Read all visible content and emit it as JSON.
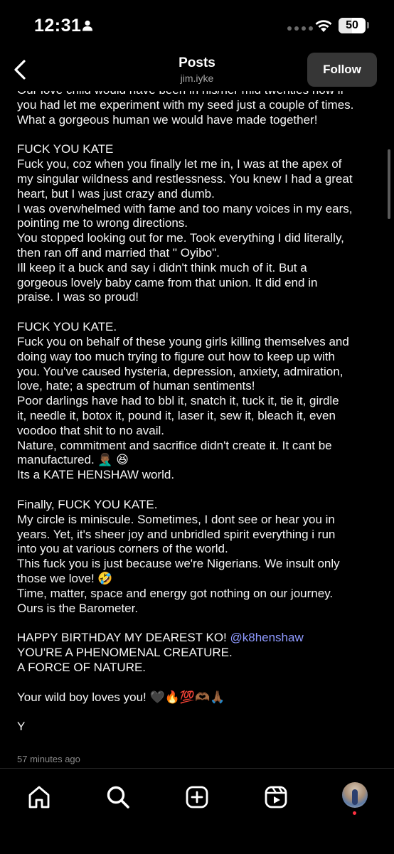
{
  "status_bar": {
    "time": "12:31",
    "battery": "50"
  },
  "header": {
    "title": "Posts",
    "username": "jim.iyke",
    "follow_label": "Follow"
  },
  "post": {
    "lines": [
      "Our love child would have been in his/her mid twenties now if",
      "you had let me experiment with my seed just a couple of times.",
      "What a gorgeous human we would have made together!",
      "",
      "FUCK YOU KATE",
      "Fuck you, coz when you finally let me in, I was at the apex of",
      "my singular wildness and restlessness. You knew I had a great",
      "heart, but I was just crazy and dumb.",
      "I was overwhelmed with fame and too many voices in my ears,",
      "pointing me to wrong directions.",
      "You stopped looking out for me. Took everything I did literally,",
      "then ran off and married that \" Oyibo\".",
      "Ill keep it a buck and say i didn't think much of it. But a",
      "gorgeous lovely baby came from that union. It did end in",
      "praise. I was so proud!",
      "",
      "FUCK YOU KATE.",
      "Fuck you on behalf of these young girls killing themselves and",
      "doing way too much trying to figure out how to keep up with",
      "you. You've caused hysteria, depression, anxiety, admiration,",
      "love, hate; a spectrum of human sentiments!",
      "Poor darlings have had to bbl it, snatch it, tuck it, tie it, girdle",
      "it, needle it, botox it, pound it, laser it, sew it, bleach it, even",
      "voodoo that shit to no avail.",
      "Nature, commitment and sacrifice didn't create it. It cant be",
      "manufactured. 🤦🏾‍♂️ 😆",
      "Its a KATE HENSHAW world.",
      "",
      "Finally, FUCK YOU KATE.",
      "My circle is miniscule. Sometimes, I dont see or hear you in",
      "years. Yet, it's sheer joy and unbridled spirit everything i run",
      "into you at various corners of the world.",
      "This fuck you is just because we're Nigerians. We insult only",
      "those we love! 🤣",
      "Time, matter, space and energy got nothing on our journey.",
      "Ours is the Barometer.",
      ""
    ],
    "birthday_prefix": "HAPPY BIRTHDAY MY DEAREST KO! ",
    "mention": "@k8henshaw",
    "closing_lines": [
      "YOU'RE A PHENOMENAL CREATURE.",
      "A FORCE OF NATURE.",
      "",
      "Your wild boy loves you! 🖤🔥💯🫶🏾🙏🏾",
      "",
      "Y"
    ],
    "timestamp": "57 minutes ago"
  },
  "nav": {
    "items": [
      "home",
      "search",
      "create",
      "reels",
      "profile"
    ]
  },
  "colors": {
    "background": "#000000",
    "mention": "#8f9aff",
    "follow_bg": "#363636",
    "notification": "#ff3040"
  }
}
